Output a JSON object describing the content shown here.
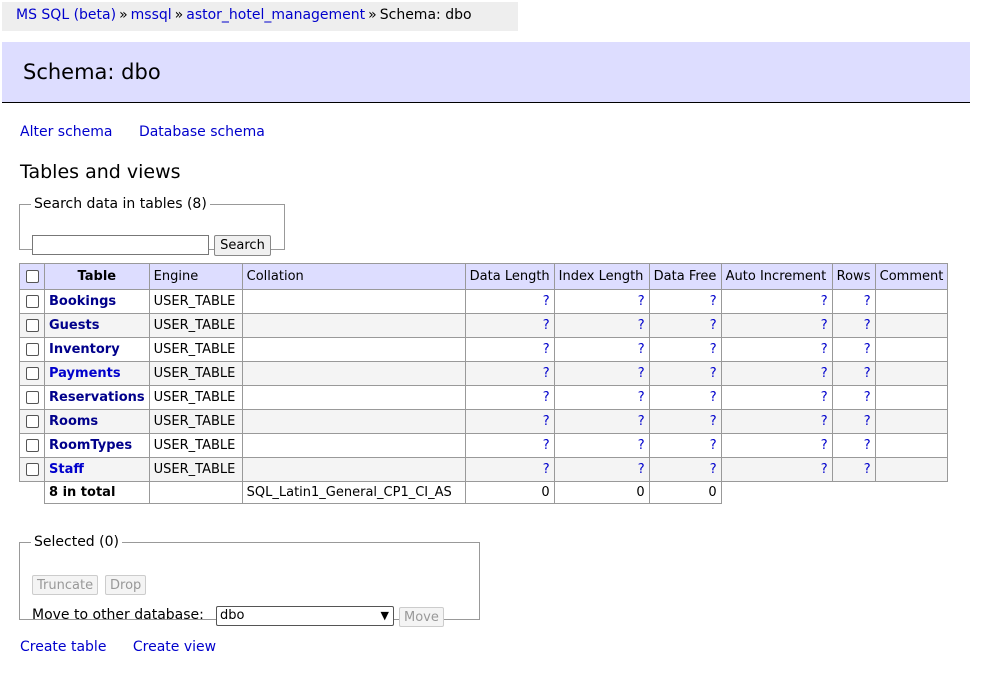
{
  "breadcrumb": {
    "items": [
      "MS SQL (beta)",
      "mssql",
      "astor_hotel_management"
    ],
    "current": "Schema: dbo",
    "separator": "»"
  },
  "header": {
    "title": "Schema: dbo"
  },
  "links_top": [
    "Alter schema",
    "Database schema"
  ],
  "section_title": "Tables and views",
  "search": {
    "legend": "Search data in tables (8)",
    "value": "",
    "button": "Search"
  },
  "table": {
    "headers": [
      "Table",
      "Engine",
      "Collation",
      "Data Length",
      "Index Length",
      "Data Free",
      "Auto Increment",
      "Rows",
      "Comment"
    ],
    "rows": [
      {
        "name": "Bookings",
        "engine": "USER_TABLE",
        "collation": "",
        "data_length": "?",
        "index_length": "?",
        "data_free": "?",
        "auto_increment": "?",
        "rows": "?",
        "comment": ""
      },
      {
        "name": "Guests",
        "engine": "USER_TABLE",
        "collation": "",
        "data_length": "?",
        "index_length": "?",
        "data_free": "?",
        "auto_increment": "?",
        "rows": "?",
        "comment": ""
      },
      {
        "name": "Inventory",
        "engine": "USER_TABLE",
        "collation": "",
        "data_length": "?",
        "index_length": "?",
        "data_free": "?",
        "auto_increment": "?",
        "rows": "?",
        "comment": ""
      },
      {
        "name": "Payments",
        "engine": "USER_TABLE",
        "collation": "",
        "data_length": "?",
        "index_length": "?",
        "data_free": "?",
        "auto_increment": "?",
        "rows": "?",
        "comment": ""
      },
      {
        "name": "Reservations",
        "engine": "USER_TABLE",
        "collation": "",
        "data_length": "?",
        "index_length": "?",
        "data_free": "?",
        "auto_increment": "?",
        "rows": "?",
        "comment": ""
      },
      {
        "name": "Rooms",
        "engine": "USER_TABLE",
        "collation": "",
        "data_length": "?",
        "index_length": "?",
        "data_free": "?",
        "auto_increment": "?",
        "rows": "?",
        "comment": ""
      },
      {
        "name": "RoomTypes",
        "engine": "USER_TABLE",
        "collation": "",
        "data_length": "?",
        "index_length": "?",
        "data_free": "?",
        "auto_increment": "?",
        "rows": "?",
        "comment": ""
      },
      {
        "name": "Staff",
        "engine": "USER_TABLE",
        "collation": "",
        "data_length": "?",
        "index_length": "?",
        "data_free": "?",
        "auto_increment": "?",
        "rows": "?",
        "comment": ""
      }
    ],
    "footer": {
      "total": "8 in total",
      "collation": "SQL_Latin1_General_CP1_CI_AS",
      "data_length": "0",
      "index_length": "0",
      "data_free": "0"
    }
  },
  "selected": {
    "legend": "Selected (0)",
    "truncate": "Truncate",
    "drop": "Drop",
    "move_label": "Move to other database:",
    "database": "dbo",
    "move_button": "Move"
  },
  "links_bottom": [
    "Create table",
    "Create view"
  ],
  "colors": {
    "header_bg": "#ddddff",
    "link": "#0000cc",
    "breadcrumb_bg": "#eeeeee"
  }
}
